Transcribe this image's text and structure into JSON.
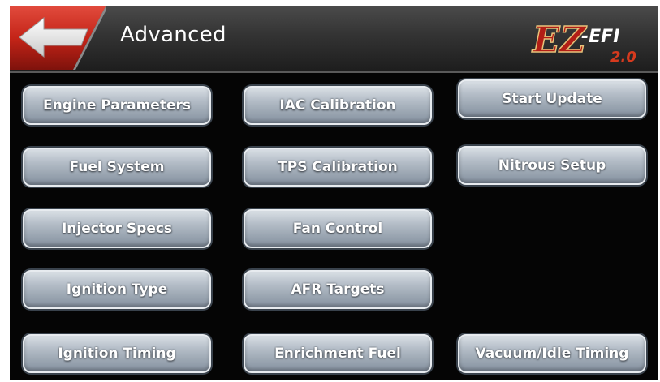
{
  "header": {
    "title": "Advanced",
    "back_icon": "back-arrow-icon",
    "brand": {
      "logo_text_main": "EZ",
      "logo_text_sub": "-EFI",
      "logo_version": "2.0"
    }
  },
  "buttons": {
    "engine_parameters": "Engine Parameters",
    "iac_calibration": "IAC Calibration",
    "start_update": "Start Update",
    "fuel_system": "Fuel System",
    "tps_calibration": "TPS Calibration",
    "nitrous_setup": "Nitrous Setup",
    "injector_specs": "Injector Specs",
    "fan_control": "Fan Control",
    "ignition_type": "Ignition Type",
    "afr_targets": "AFR Targets",
    "ignition_timing": "Ignition Timing",
    "enrichment_fuel": "Enrichment Fuel",
    "vacuum_idle_timing": "Vacuum/Idle Timing"
  },
  "colors": {
    "accent_red": "#c8281e",
    "button_silver": "#a4afba",
    "background": "#050505"
  }
}
